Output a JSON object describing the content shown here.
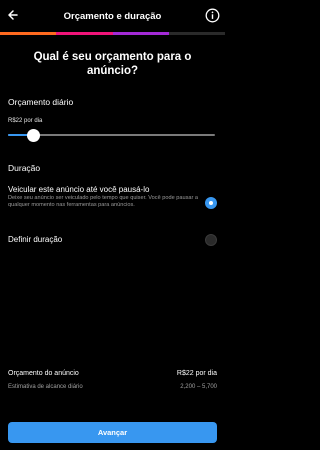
{
  "header": {
    "title": "Orçamento e duração",
    "back_icon": "arrow-left-icon",
    "info_icon": "info-circle-icon"
  },
  "progress": {
    "steps": 4,
    "current_step": 3,
    "colors": [
      "#ff6a1f",
      "#f0147a",
      "#a32ad6",
      "#2a2a2a"
    ]
  },
  "question": "Qual é seu orçamento para o anúncio?",
  "budget": {
    "label": "Orçamento diário",
    "value_text": "R$22 por dia",
    "slider_level": 0.12,
    "accent": "#3897f0"
  },
  "duration": {
    "label": "Duração",
    "options": [
      {
        "title": "Veicular este anúncio até você pausá-lo",
        "description": "Deixe seu anúncio ser veiculado pelo tempo que quiser. Você pode pausar a qualquer momento nas ferramentas para anúncios.",
        "selected": true
      },
      {
        "title": "Definir duração",
        "description": "",
        "selected": false
      }
    ]
  },
  "summary": {
    "budget_label": "Orçamento do anúncio",
    "budget_value": "R$22 por dia",
    "reach_label": "Estimativa de alcance diário",
    "reach_value": "2,200 – 5,700"
  },
  "cta": {
    "label": "Avançar"
  }
}
